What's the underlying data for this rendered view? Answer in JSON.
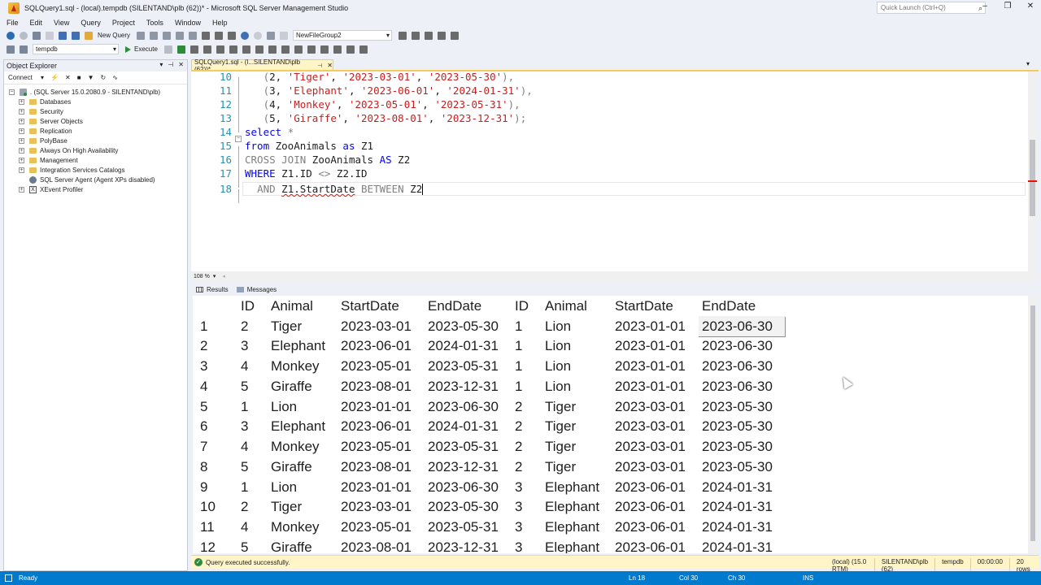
{
  "window": {
    "title": "SQLQuery1.sql - (local).tempdb (SILENTAND\\plb (62))* - Microsoft SQL Server Management Studio",
    "quick_launch_placeholder": "Quick Launch (Ctrl+Q)"
  },
  "menu": [
    "File",
    "Edit",
    "View",
    "Query",
    "Project",
    "Tools",
    "Window",
    "Help"
  ],
  "toolbar": {
    "new_query": "New Query",
    "filegroup": "NewFileGroup2",
    "database": "tempdb",
    "execute": "Execute"
  },
  "object_explorer": {
    "title": "Object Explorer",
    "connect": "Connect",
    "server": ". (SQL Server 15.0.2080.9 - SILENTAND\\plb)",
    "nodes": [
      "Databases",
      "Security",
      "Server Objects",
      "Replication",
      "PolyBase",
      "Always On High Availability",
      "Management",
      "Integration Services Catalogs",
      "SQL Server Agent (Agent XPs disabled)",
      "XEvent Profiler"
    ]
  },
  "editor": {
    "tab_title": "SQLQuery1.sql - (l...SILENTAND\\plb (62))*",
    "zoom": "108 %",
    "lines": {
      "n10": "10",
      "n11": "11",
      "n12": "12",
      "n13": "13",
      "n14": "14",
      "n15": "15",
      "n16": "16",
      "n17": "17",
      "n18": "18",
      "l10": "(2, 'Tiger', '2023-03-01', '2023-05-30'),",
      "l11": "(3, 'Elephant', '2023-06-01', '2024-01-31'),",
      "l12": "(4, 'Monkey', '2023-05-01', '2023-05-31'),",
      "l13": "(5, 'Giraffe', '2023-08-01', '2023-12-31');",
      "l14": "select *",
      "l15": "from ZooAnimals as Z1",
      "l16": "CROSS JOIN ZooAnimals AS Z2",
      "l17": "WHERE Z1.ID <> Z2.ID",
      "l18": "AND Z1.StartDate BETWEEN Z2"
    }
  },
  "results": {
    "tab_results": "Results",
    "tab_messages": "Messages",
    "columns": [
      "ID",
      "Animal",
      "StartDate",
      "EndDate",
      "ID",
      "Animal",
      "StartDate",
      "EndDate"
    ],
    "rows": [
      [
        "1",
        "2",
        "Tiger",
        "2023-03-01",
        "2023-05-30",
        "1",
        "Lion",
        "2023-01-01",
        "2023-06-30"
      ],
      [
        "2",
        "3",
        "Elephant",
        "2023-06-01",
        "2024-01-31",
        "1",
        "Lion",
        "2023-01-01",
        "2023-06-30"
      ],
      [
        "3",
        "4",
        "Monkey",
        "2023-05-01",
        "2023-05-31",
        "1",
        "Lion",
        "2023-01-01",
        "2023-06-30"
      ],
      [
        "4",
        "5",
        "Giraffe",
        "2023-08-01",
        "2023-12-31",
        "1",
        "Lion",
        "2023-01-01",
        "2023-06-30"
      ],
      [
        "5",
        "1",
        "Lion",
        "2023-01-01",
        "2023-06-30",
        "2",
        "Tiger",
        "2023-03-01",
        "2023-05-30"
      ],
      [
        "6",
        "3",
        "Elephant",
        "2023-06-01",
        "2024-01-31",
        "2",
        "Tiger",
        "2023-03-01",
        "2023-05-30"
      ],
      [
        "7",
        "4",
        "Monkey",
        "2023-05-01",
        "2023-05-31",
        "2",
        "Tiger",
        "2023-03-01",
        "2023-05-30"
      ],
      [
        "8",
        "5",
        "Giraffe",
        "2023-08-01",
        "2023-12-31",
        "2",
        "Tiger",
        "2023-03-01",
        "2023-05-30"
      ],
      [
        "9",
        "1",
        "Lion",
        "2023-01-01",
        "2023-06-30",
        "3",
        "Elephant",
        "2023-06-01",
        "2024-01-31"
      ],
      [
        "10",
        "2",
        "Tiger",
        "2023-03-01",
        "2023-05-30",
        "3",
        "Elephant",
        "2023-06-01",
        "2024-01-31"
      ],
      [
        "11",
        "4",
        "Monkey",
        "2023-05-01",
        "2023-05-31",
        "3",
        "Elephant",
        "2023-06-01",
        "2024-01-31"
      ],
      [
        "12",
        "5",
        "Giraffe",
        "2023-08-01",
        "2023-12-31",
        "3",
        "Elephant",
        "2023-06-01",
        "2024-01-31"
      ]
    ]
  },
  "query_status": {
    "message": "Query executed successfully.",
    "server": "(local) (15.0 RTM)",
    "user": "SILENTAND\\plb (62)",
    "database": "tempdb",
    "elapsed": "00:00:00",
    "rows": "20 rows"
  },
  "statusbar": {
    "state": "Ready",
    "line": "Ln 18",
    "col": "Col 30",
    "ch": "Ch 30",
    "mode": "INS"
  },
  "colors": {
    "accent": "#007acc",
    "keyword": "#0000ff",
    "string": "#c81e1e",
    "line_number": "#2b91af",
    "tab_active": "#fff5c7"
  }
}
